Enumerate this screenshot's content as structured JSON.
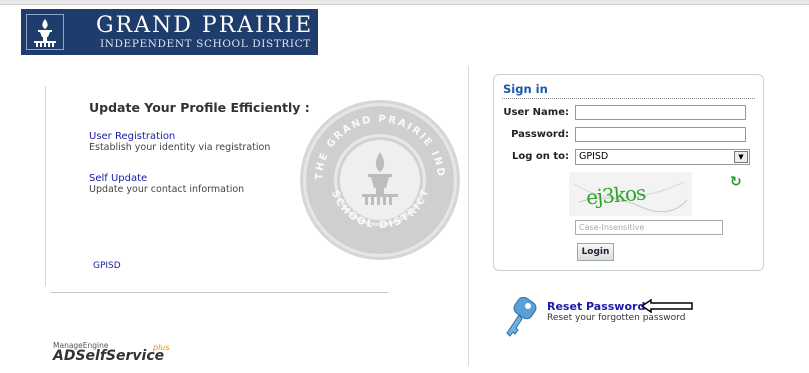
{
  "logo": {
    "line1": "GRAND PRAIRIE",
    "line2": "INDEPENDENT SCHOOL DISTRICT"
  },
  "left": {
    "headline": "Update Your Profile Efficiently :",
    "items": [
      {
        "title": "User Registration",
        "desc": "Establish your identity via registration"
      },
      {
        "title": "Self Update",
        "desc": "Update your contact information"
      }
    ],
    "domain_link": "GPISD"
  },
  "seal": {
    "top_text": "THE GRAND PRAIRIE INDEPENDENT",
    "bottom_text": "SCHOOL DISTRICT"
  },
  "signin": {
    "title": "Sign in",
    "username_label": "User Name:",
    "username_value": "",
    "password_label": "Password:",
    "password_value": "",
    "logon_label": "Log on to:",
    "logon_value": "GPISD",
    "captcha_text": "ej3kos",
    "captcha_placeholder": "Case-Insensitive",
    "login_label": "Login"
  },
  "reset": {
    "title": "Reset Password",
    "desc": "Reset your forgotten password"
  },
  "brand": {
    "small": "ManageEngine",
    "name": "ADSelfService",
    "plus": "plus"
  },
  "colors": {
    "banner": "#1f3d6c",
    "link": "#1a1aa6",
    "signin_title": "#1a5aa5",
    "captcha_green": "#2aa52a"
  },
  "icons": {
    "logo": "torch-emblem-icon",
    "refresh": "refresh-icon",
    "key": "key-icon",
    "annotation": "arrow-left-icon"
  }
}
